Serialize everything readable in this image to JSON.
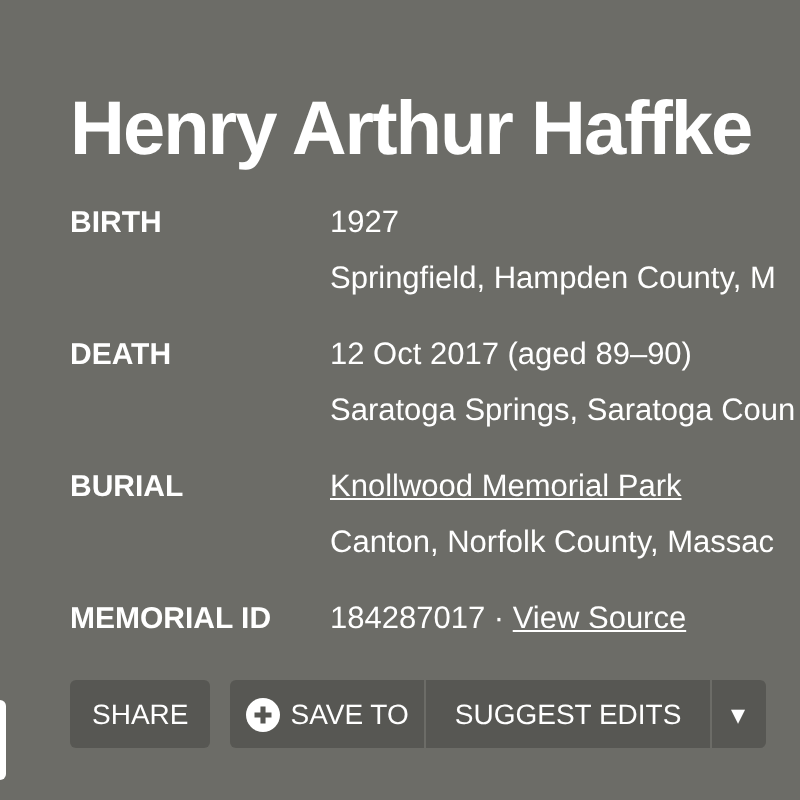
{
  "title": "Henry Arthur Haffke",
  "facts": [
    {
      "label": "BIRTH",
      "lines": [
        {
          "text": "1927"
        },
        {
          "text": "Springfield, Hampden County, M"
        }
      ]
    },
    {
      "label": "DEATH",
      "lines": [
        {
          "text": "12 Oct 2017 (aged 89–90)"
        },
        {
          "text": "Saratoga Springs, Saratoga Coun"
        }
      ]
    },
    {
      "label": "BURIAL",
      "lines": [
        {
          "text": "Knollwood Memorial Park",
          "link": true
        },
        {
          "text": "Canton, Norfolk County, Massac"
        }
      ]
    },
    {
      "label": "MEMORIAL ID",
      "value": "184287017 · ",
      "link_text": "View Source"
    }
  ],
  "buttons": {
    "share": "SHARE",
    "save": "SAVE TO",
    "suggest": "SUGGEST EDITS",
    "menu": "▾"
  }
}
